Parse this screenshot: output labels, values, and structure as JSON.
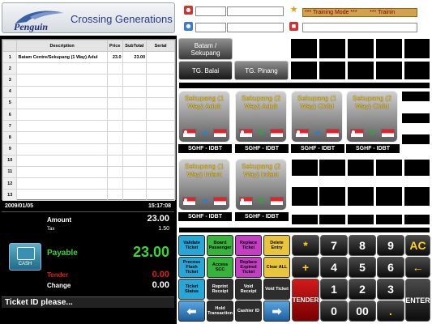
{
  "brand": {
    "name": "Penguin",
    "tagline": "Crossing Generations"
  },
  "header": {
    "training_mode": "*** Training Mode ***        *** Trainin"
  },
  "table": {
    "headers": [
      "",
      "Description",
      "Price",
      "SubTotal",
      "Serial"
    ],
    "rows": [
      {
        "no": "1",
        "desc": "Batam Centre/Sekupang (1 Way) Adul",
        "price": "23.0",
        "subtotal": "23.00",
        "serial": ""
      },
      {
        "no": "2",
        "desc": "",
        "price": "",
        "subtotal": "",
        "serial": ""
      },
      {
        "no": "3",
        "desc": "",
        "price": "",
        "subtotal": "",
        "serial": ""
      },
      {
        "no": "4",
        "desc": "",
        "price": "",
        "subtotal": "",
        "serial": ""
      },
      {
        "no": "5",
        "desc": "",
        "price": "",
        "subtotal": "",
        "serial": ""
      },
      {
        "no": "6",
        "desc": "",
        "price": "",
        "subtotal": "",
        "serial": ""
      },
      {
        "no": "7",
        "desc": "",
        "price": "",
        "subtotal": "",
        "serial": ""
      },
      {
        "no": "8",
        "desc": "",
        "price": "",
        "subtotal": "",
        "serial": ""
      },
      {
        "no": "9",
        "desc": "",
        "price": "",
        "subtotal": "",
        "serial": ""
      },
      {
        "no": "10",
        "desc": "",
        "price": "",
        "subtotal": "",
        "serial": ""
      },
      {
        "no": "11",
        "desc": "",
        "price": "",
        "subtotal": "",
        "serial": ""
      },
      {
        "no": "12",
        "desc": "",
        "price": "",
        "subtotal": "",
        "serial": ""
      },
      {
        "no": "13",
        "desc": "",
        "price": "",
        "subtotal": "",
        "serial": ""
      }
    ]
  },
  "totals": {
    "date": "2009/01/05",
    "time": "15:17:08",
    "amount_label": "Amount",
    "amount": "23.00",
    "tax_label": "Tax",
    "tax": "1.50",
    "payable_label": "Payable",
    "payable": "23.00",
    "tender_label": "Tender",
    "tender": "0.00",
    "change_label": "Change",
    "change": "0.00",
    "cash_label": "CASH"
  },
  "status": "Ticket ID please...",
  "routes": {
    "batam": "Batam / Sekupang",
    "balai": "TG. Balai",
    "pinang": "TG. Pinang"
  },
  "tickets": [
    {
      "label": "Sekupang (1 Way) Adult",
      "operator": "SGHF - IDBT",
      "trip": "one-way"
    },
    {
      "label": "Sekupang (2 Way) Adult",
      "operator": "SGHF - IDBT",
      "trip": "round"
    },
    {
      "label": "Sekupang (1 Way) Child",
      "operator": "SGHF - IDBT",
      "trip": "one-way"
    },
    {
      "label": "Sekupang (2 Way) Child",
      "operator": "SGHF - IDBT",
      "trip": "round"
    },
    {
      "label": "Sekupang (1 Way) Infant",
      "operator": "SGHF - IDBT",
      "trip": "one-way"
    },
    {
      "label": "Sekupang (2 Way) Infant",
      "operator": "SGHF - IDBT",
      "trip": "round"
    }
  ],
  "functions": [
    {
      "label": "Validate Ticket",
      "color": "#27a6d8",
      "text": "#000"
    },
    {
      "label": "Board Passenger",
      "color": "#36b33a",
      "text": "#000"
    },
    {
      "label": "Replace Ticket",
      "color": "#c43ec4",
      "text": "#000"
    },
    {
      "label": "Delete Entry",
      "color": "#e8c53a",
      "text": "#000"
    },
    {
      "label": "Process Flash Ticket",
      "color": "#27a6d8",
      "text": "#000"
    },
    {
      "label": "Access SCC",
      "color": "#36b33a",
      "text": "#000"
    },
    {
      "label": "Replace Expired Ticket",
      "color": "#c43ec4",
      "text": "#000"
    },
    {
      "label": "Clear ALL",
      "color": "#e8c53a",
      "text": "#000"
    },
    {
      "label": "Ticket Status",
      "color": "#27a6d8",
      "text": "#000"
    },
    {
      "label": "Reprint Receipt",
      "color": "#2d2d2d",
      "text": "#fff"
    },
    {
      "label": "Void Receipt",
      "color": "#2d2d2d",
      "text": "#fff"
    },
    {
      "label": "Void Ticket",
      "color": "#2d2d2d",
      "text": "#fff"
    },
    {
      "label": "",
      "color": "#2d2d2d",
      "text": "#fff"
    },
    {
      "label": "Hold Transaction",
      "color": "#2d2d2d",
      "text": "#fff"
    },
    {
      "label": "Cashier ID",
      "color": "#2d2d2d",
      "text": "#fff"
    },
    {
      "label": "",
      "color": "#2d2d2d",
      "text": "#fff"
    }
  ],
  "keypad": {
    "star": "*",
    "plus": "+",
    "k7": "7",
    "k8": "8",
    "k9": "9",
    "k4": "4",
    "k5": "5",
    "k6": "6",
    "k1": "1",
    "k2": "2",
    "k3": "3",
    "k0": "0",
    "k00": "00",
    "dot": ".",
    "ac": "AC",
    "back": "←",
    "tender": "TENDER",
    "enter": "ENTER"
  }
}
